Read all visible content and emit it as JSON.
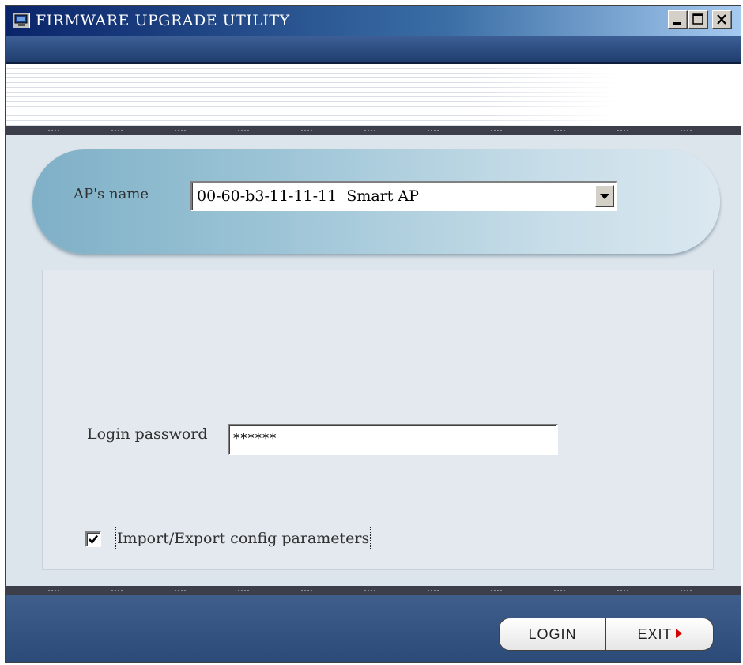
{
  "window": {
    "title": "FIRMWARE UPGRADE UTILITY",
    "controls": [
      "minimize",
      "maximize",
      "close"
    ]
  },
  "ap_selector": {
    "label": "AP's name",
    "selected_value": "00-60-b3-11-11-11  Smart AP"
  },
  "login": {
    "password_label": "Login password",
    "password_value": "******"
  },
  "options": {
    "import_export_label": "Import/Export config parameters",
    "import_export_checked": true
  },
  "buttons": {
    "login_label": "LOGIN",
    "exit_label": "EXIT"
  },
  "colors": {
    "title_bar": "#0a246a",
    "footer": "#2c4a78",
    "exit_arrow": "#d40000"
  }
}
